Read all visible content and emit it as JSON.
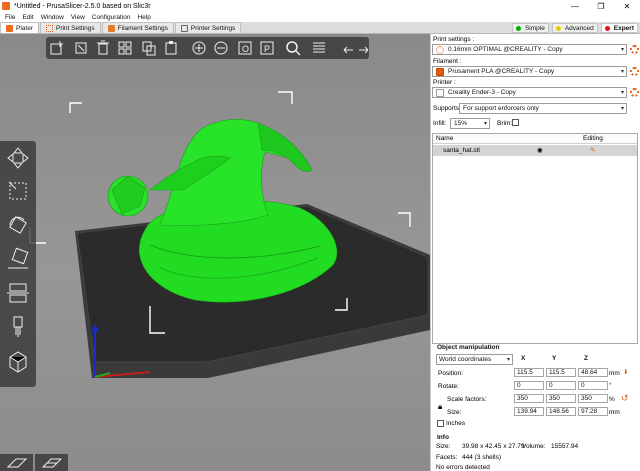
{
  "window": {
    "title": "*Untitled - PrusaSlicer-2.5.0 based on Slic3r",
    "minimize": "—",
    "maximize": "❐",
    "close": "✕"
  },
  "menu": [
    "File",
    "Edit",
    "Window",
    "View",
    "Configuration",
    "Help"
  ],
  "tabs": [
    {
      "label": "Plater",
      "active": true
    },
    {
      "label": "Print Settings"
    },
    {
      "label": "Filament Settings"
    },
    {
      "label": "Printer Settings"
    }
  ],
  "modes": [
    {
      "label": "Simple",
      "color": "#00b000"
    },
    {
      "label": "Advanced",
      "color": "#e8d000"
    },
    {
      "label": "Expert",
      "color": "#e01010",
      "active": true
    }
  ],
  "sidebar": {
    "print_settings_label": "Print settings :",
    "print_settings_value": "0.16mm OPTIMAL @CREALITY - Copy",
    "filament_label": "Filament :",
    "filament_value": "Prusament PLA @CREALITY - Copy",
    "filament_color": "#e85a10",
    "printer_label": "Printer :",
    "printer_value": "Creality Ender-3 - Copy",
    "supports_label": "Supports:",
    "supports_value": "For support enforcers only",
    "infill_label": "Infill:",
    "infill_value": "15%",
    "brim_label": "Brim:"
  },
  "object_list": {
    "col_name": "Name",
    "col_editing": "Editing",
    "rows": [
      {
        "name": "santa_hat.stl"
      }
    ]
  },
  "object_manipulation": {
    "title": "Object manipulation",
    "coord_system": "World coordinates",
    "axes": [
      "X",
      "Y",
      "Z"
    ],
    "position_label": "Position:",
    "position": [
      "115.5",
      "115.5",
      "48.64"
    ],
    "position_unit": "mm",
    "rotate_label": "Rotate:",
    "rotate": [
      "0",
      "0",
      "0"
    ],
    "rotate_unit": "°",
    "scale_label": "Scale factors:",
    "scale": [
      "350",
      "350",
      "350"
    ],
    "scale_unit": "%",
    "size_label": "Size:",
    "size": [
      "139.94",
      "148.56",
      "97.28"
    ],
    "size_unit": "mm",
    "inches_label": "Inches"
  },
  "info": {
    "title": "Info",
    "size_label": "Size:",
    "size_value": "39.98 x 42.45 x 27.79",
    "volume_label": "Volume:",
    "volume_value": "15557.94",
    "facets_label": "Facets:",
    "facets_value": "444 (3 shells)",
    "errors": "No errors detected"
  },
  "colors": {
    "accent": "#ed6b21",
    "model": "#20e020",
    "bed": "#2e2e2e"
  }
}
